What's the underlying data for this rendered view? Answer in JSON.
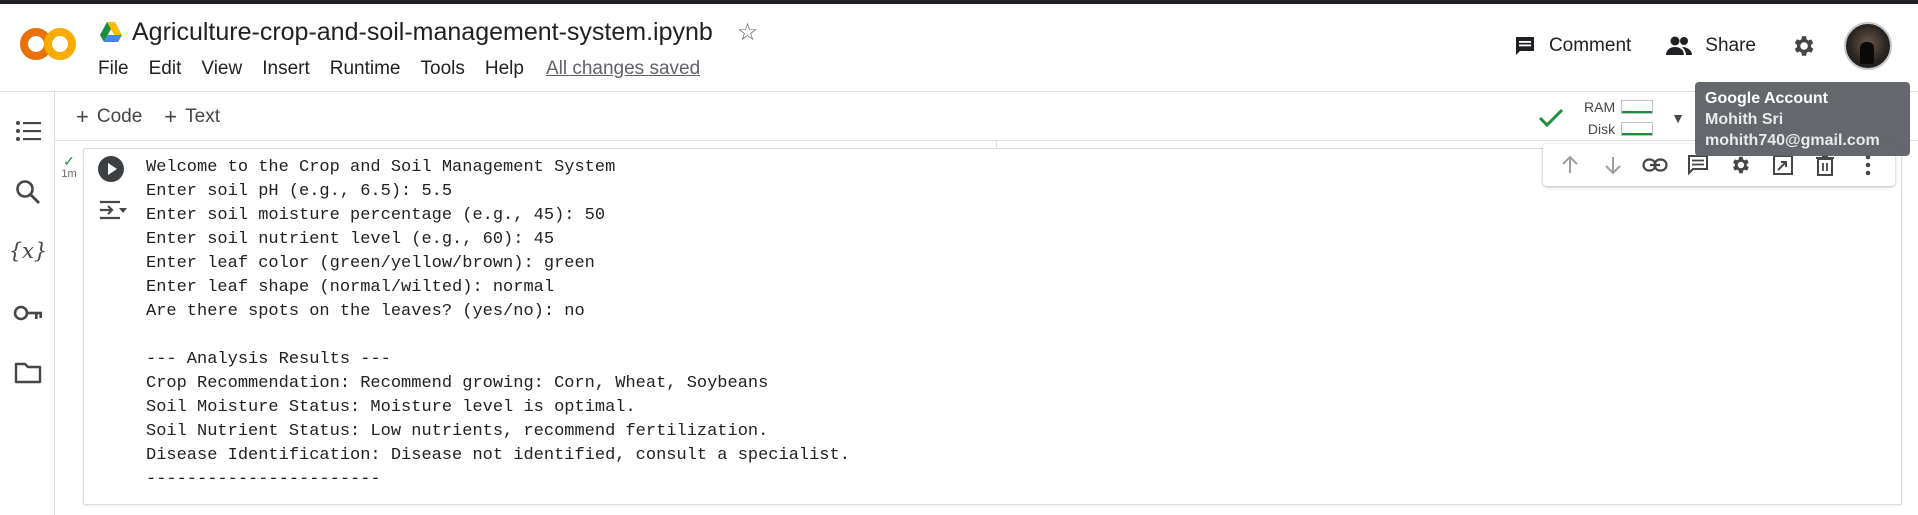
{
  "app": {
    "name": "Google Colab",
    "logo_text": "CO"
  },
  "header": {
    "title": "Agriculture-crop-and-soil-management-system.ipynb",
    "menu": [
      "File",
      "Edit",
      "View",
      "Insert",
      "Runtime",
      "Tools",
      "Help"
    ],
    "save_status": "All changes saved",
    "comment_label": "Comment",
    "share_label": "Share"
  },
  "toolbar": {
    "code_label": "Code",
    "text_label": "Text",
    "ram_label": "RAM",
    "disk_label": "Disk"
  },
  "tooltip": {
    "title": "Google Account",
    "name": "Mohith Sri",
    "email": "mohith740@gmail.com"
  },
  "cell": {
    "exec_time": "1m",
    "output_lines": [
      "Welcome to the Crop and Soil Management System",
      "Enter soil pH (e.g., 6.5): 5.5",
      "Enter soil moisture percentage (e.g., 45): 50",
      "Enter soil nutrient level (e.g., 60): 45",
      "Enter leaf color (green/yellow/brown): green",
      "Enter leaf shape (normal/wilted): normal",
      "Are there spots on the leaves? (yes/no): no",
      "",
      "--- Analysis Results ---",
      "Crop Recommendation: Recommend growing: Corn, Wheat, Soybeans",
      "Soil Moisture Status: Moisture level is optimal.",
      "Soil Nutrient Status: Low nutrients, recommend fertilization.",
      "Disease Identification: Disease not identified, consult a specialist.",
      "-----------------------"
    ]
  },
  "icons": {
    "sidebar": [
      "table-of-contents-icon",
      "search-icon",
      "variables-icon",
      "key-icon",
      "folder-icon"
    ],
    "cell_toolbar": [
      "arrow-up-icon",
      "arrow-down-icon",
      "link-icon",
      "comment-icon",
      "gear-icon",
      "mirror-cell-icon",
      "delete-icon",
      "more-icon"
    ]
  },
  "colors": {
    "logo_orange": "#F9AB00",
    "logo_orange_dark": "#E8710A",
    "accent_green": "#1E8E3E",
    "tooltip_bg": "#5F6368"
  }
}
